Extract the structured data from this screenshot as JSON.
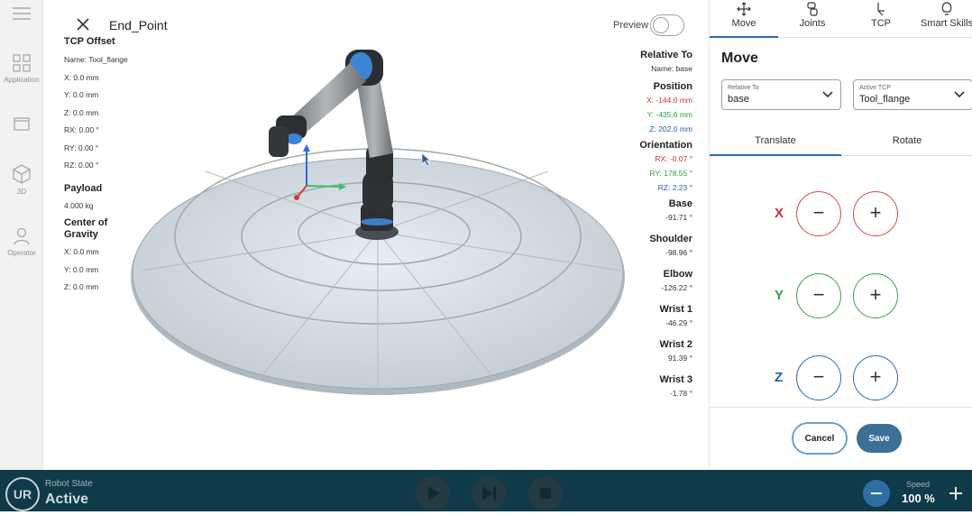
{
  "left_rail": {
    "items": [
      {
        "label": "Application",
        "icon": "grid-icon"
      },
      {
        "label": "",
        "icon": "window-icon"
      },
      {
        "label": "3D",
        "icon": "cube-icon"
      },
      {
        "label": "Operator",
        "icon": "person-icon"
      }
    ]
  },
  "header": {
    "title": "End_Point",
    "preview_label": "Preview",
    "preview_on": false
  },
  "tcp_offset": {
    "heading": "TCP Offset",
    "name": "Name: Tool_flange",
    "x": "X: 0.0 mm",
    "y": "Y: 0.0 mm",
    "z": "Z: 0.0 mm",
    "rx": "RX: 0.00 °",
    "ry": "RY: 0.00 °",
    "rz": "RZ: 0.00 °"
  },
  "payload": {
    "heading": "Payload",
    "value": "4.000 kg"
  },
  "cog": {
    "heading": "Center of Gravity",
    "x": "X: 0.0 mm",
    "y": "Y: 0.0 mm",
    "z": "Z: 0.0 mm"
  },
  "relative_to": {
    "heading": "Relative To",
    "name": "Name: base"
  },
  "position": {
    "heading": "Position",
    "x": "X: -144.0 mm",
    "y": "Y: -435.6 mm",
    "z": "Z: 202.0 mm"
  },
  "orientation": {
    "heading": "Orientation",
    "rx": "RX: -0.07 °",
    "ry": "RY: 178.55 °",
    "rz": "RZ: 2.23 °"
  },
  "joints": [
    {
      "name": "Base",
      "value": "-91.71 °"
    },
    {
      "name": "Shoulder",
      "value": "-98.96 °"
    },
    {
      "name": "Elbow",
      "value": "-126.22 °"
    },
    {
      "name": "Wrist 1",
      "value": "-46.29 °"
    },
    {
      "name": "Wrist 2",
      "value": "91.39 °"
    },
    {
      "name": "Wrist 3",
      "value": "-1.78 °"
    }
  ],
  "panel": {
    "tabs": [
      {
        "label": "Move",
        "icon": "move-arrows-icon",
        "active": true
      },
      {
        "label": "Joints",
        "icon": "joint-icon",
        "active": false
      },
      {
        "label": "TCP",
        "icon": "tcp-icon",
        "active": false
      },
      {
        "label": "Smart Skills",
        "icon": "lightbulb-icon",
        "active": false
      }
    ],
    "title": "Move",
    "relative_to": {
      "label": "Relative To",
      "value": "base"
    },
    "active_tcp": {
      "label": "Active TCP",
      "value": "Tool_flange"
    },
    "subtabs": [
      {
        "label": "Translate",
        "active": true
      },
      {
        "label": "Rotate",
        "active": false
      }
    ],
    "axes": [
      {
        "label": "X",
        "color": "#d32f2f",
        "minus": "−",
        "plus": "+"
      },
      {
        "label": "Y",
        "color": "#2e9e3e",
        "minus": "−",
        "plus": "+"
      },
      {
        "label": "Z",
        "color": "#1f5fb0",
        "minus": "−",
        "plus": "+"
      }
    ],
    "cancel": "Cancel",
    "save": "Save"
  },
  "status_bar": {
    "logo": "UR",
    "robot_state_label": "Robot State",
    "robot_state": "Active",
    "speed_label": "Speed",
    "speed_value": "100 %"
  },
  "colors": {
    "accent": "#2a6fb0",
    "bar": "#0f3a49",
    "x_axis": "#d32f2f",
    "y_axis": "#2e9e3e",
    "z_axis": "#1f5fb0"
  }
}
